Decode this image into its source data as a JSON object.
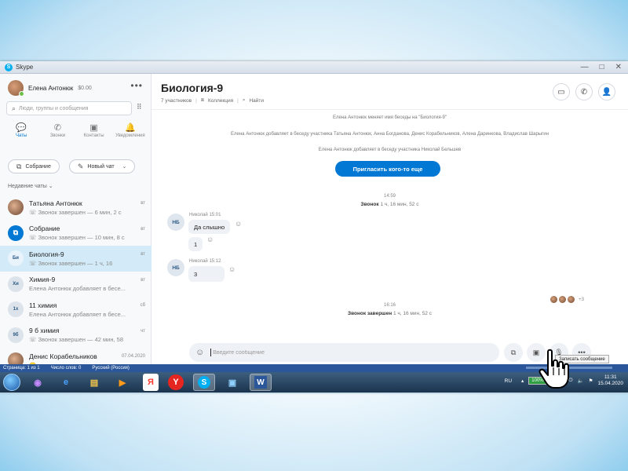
{
  "window": {
    "title": "Skype",
    "controls": [
      "—",
      "□",
      "✕"
    ]
  },
  "profile": {
    "name": "Елена Антонюк",
    "balance": "$0.00",
    "more": "•••"
  },
  "search": {
    "placeholder": "Люди, группы и сообщения"
  },
  "nav": [
    {
      "label": "Чаты",
      "icon": "💬"
    },
    {
      "label": "Звонки",
      "icon": "✆"
    },
    {
      "label": "Контакты",
      "icon": "▣"
    },
    {
      "label": "Уведомления",
      "icon": "🔔"
    }
  ],
  "buttons": {
    "meeting": "Собрание",
    "new_chat": "Новый чат"
  },
  "recent_label": "Недавние чаты",
  "chats": [
    {
      "name": "Татьяна Антонюк",
      "sub": "Звонок завершен — 6 мин, 2 с",
      "time": "вт",
      "avatar": ""
    },
    {
      "name": "Собрание",
      "sub": "Звонок завершен — 10 мин, 8 с",
      "time": "вт",
      "avatar": "⧉"
    },
    {
      "name": "Биология-9",
      "sub": "Звонок завершен — 1 ч, 16",
      "time": "вт",
      "avatar": "Би"
    },
    {
      "name": "Химия-9",
      "sub": "Елена Антонюк добавляет в бесе...",
      "time": "вт",
      "avatar": "Хи"
    },
    {
      "name": "11 химия",
      "sub": "Елена Антонюк добавляет в бесе...",
      "time": "сб",
      "avatar": "1х"
    },
    {
      "name": "9 б химия",
      "sub": "Звонок завершен — 42 мин, 58",
      "time": "чт",
      "avatar": "9б"
    },
    {
      "name": "Денис Корабельников",
      "sub": "😋",
      "time": "07.04.2020",
      "avatar": ""
    }
  ],
  "main": {
    "title": "Биология-9",
    "participants": "7 участников",
    "collection": "Коллекция",
    "find": "Найти",
    "sys1": "Елена Антонюк меняет имя беседы на \"Биология-9\"",
    "sys2": "Елена Антонюк добавляет в беседу участника Татьяна Антонюк, Анна Богданова, Денис Корабельников, Алена Даринкова, Владислав Шарыгин",
    "sys3": "Елена Антонюк добавляет в беседу участника Николай Бельшев",
    "invite": "Пригласить кого-то еще",
    "time1": "14:59",
    "call1_bold": "Звонок",
    "call1_rest": "1 ч, 16 мин, 52 с",
    "msg1_sender": "Николай 15:01",
    "msg1_text": "Да слышно",
    "msg1b_text": "1",
    "msg2_sender": "Николай 15:12",
    "msg2_text": "3",
    "avatar_initials": "НБ",
    "read_count": "+3",
    "time2": "16:16",
    "call2_bold": "Звонок завершен",
    "call2_rest": "1 ч, 16 мин, 52 с",
    "composer_placeholder": "Введите сообщение",
    "tooltip": "Записать сообщение"
  },
  "statusbar": {
    "page": "Страница: 1 из 1",
    "words": "Число слов: 0",
    "lang": "Русский (Россия)"
  },
  "taskbar": {
    "lang": "RU",
    "battery": "100%",
    "time": "11:31",
    "date": "15.04.2020"
  },
  "colors": {
    "accent": "#0078d4",
    "selected": "#d3ebf8",
    "taskbar": "#1b334d"
  }
}
